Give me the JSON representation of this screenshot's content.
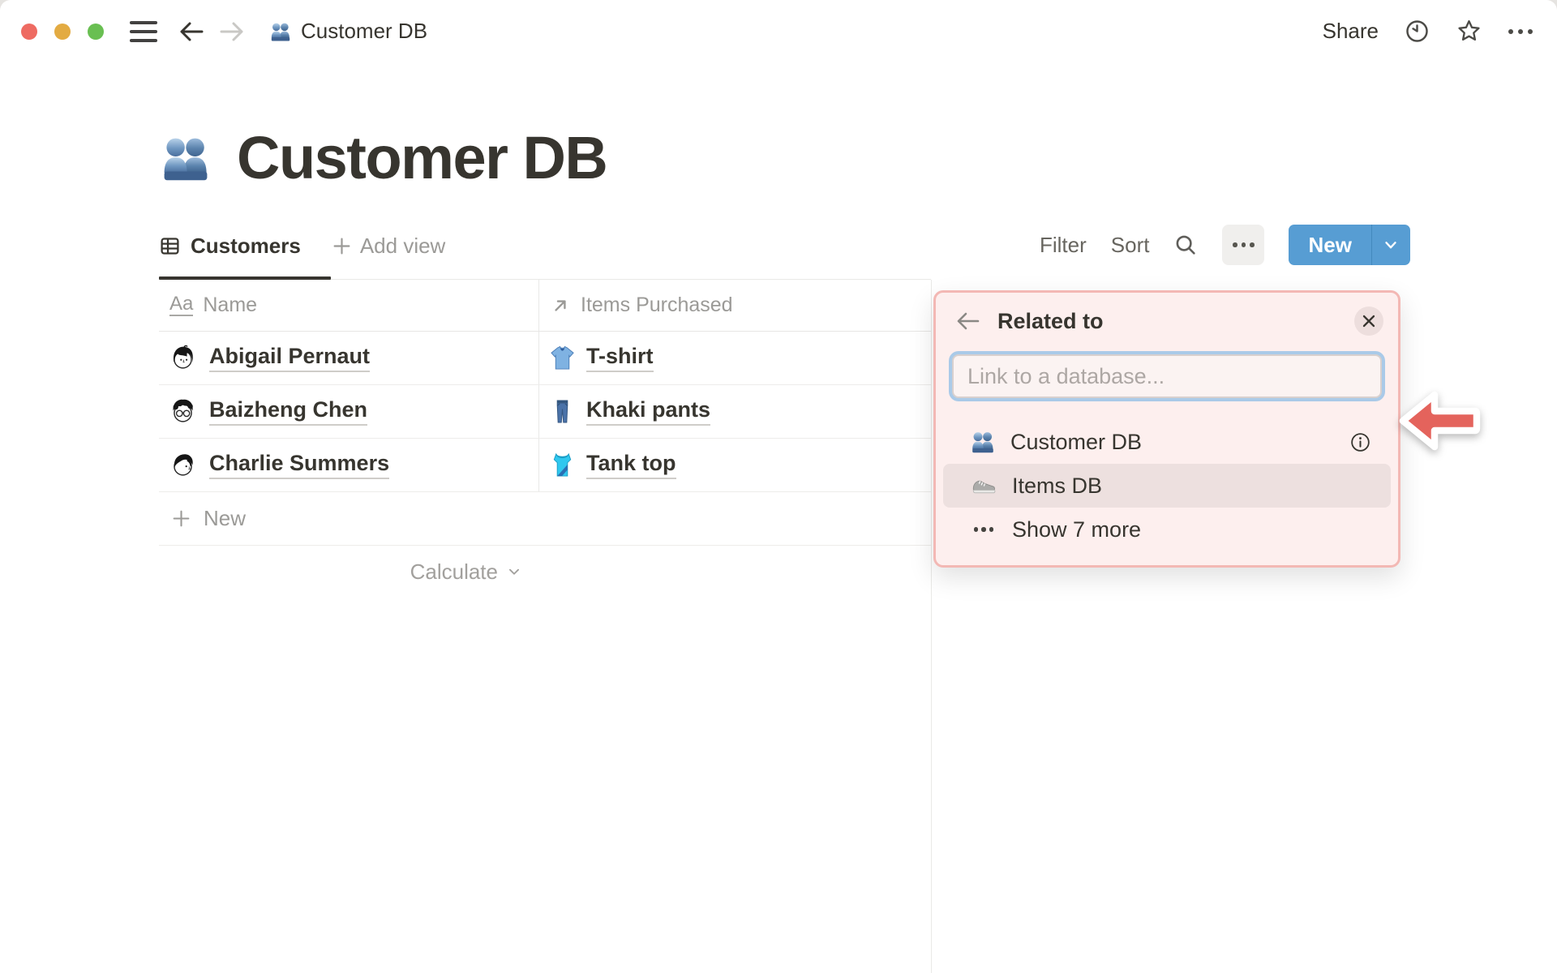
{
  "titlebar": {
    "breadcrumb": {
      "icon": "people-icon",
      "label": "Customer DB"
    },
    "share": "Share",
    "icons": [
      "history-clock-icon",
      "favorite-star-icon",
      "more-ellipsis-icon"
    ]
  },
  "page": {
    "icon": "people-icon",
    "title": "Customer DB"
  },
  "view_bar": {
    "active_tab": {
      "icon": "table-view-icon",
      "label": "Customers"
    },
    "add_view": "Add view",
    "filter": "Filter",
    "sort": "Sort",
    "new": "New"
  },
  "table": {
    "columns": [
      {
        "icon": "title-aa-icon",
        "icon_text": "Aa",
        "label": "Name"
      },
      {
        "icon": "relation-arrow-icon",
        "label": "Items Purchased"
      }
    ],
    "rows": [
      {
        "avatar": "abigail-avatar",
        "name": "Abigail Pernaut",
        "item_icon": "tshirt-icon",
        "item": "T-shirt"
      },
      {
        "avatar": "baizheng-avatar",
        "name": "Baizheng Chen",
        "item_icon": "jeans-icon",
        "item": "Khaki pants"
      },
      {
        "avatar": "charlie-avatar",
        "name": "Charlie Summers",
        "item_icon": "tanktop-icon",
        "item": "Tank top"
      }
    ],
    "new_row_label": "New",
    "calculate_label": "Calculate"
  },
  "popup": {
    "title": "Related to",
    "input_placeholder": "Link to a database...",
    "items": [
      {
        "icon": "people-icon",
        "label": "Customer DB",
        "info": true
      },
      {
        "icon": "sneaker-icon",
        "label": "Items DB",
        "highlighted": true
      },
      {
        "icon": "show-more-dots-icon",
        "label": "Show 7 more"
      }
    ]
  },
  "colors": {
    "accent_blue": "#579dd3",
    "annotation_red": "#e4635c",
    "popup_bg": "#fdefee",
    "popup_border": "#f3b8b4",
    "text_dark": "#37352f",
    "text_gray": "#9b9a97"
  }
}
